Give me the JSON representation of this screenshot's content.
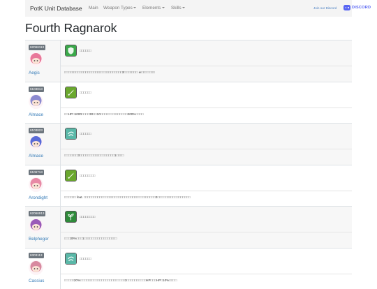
{
  "nav": {
    "brand": "PotK Unit Database",
    "items": [
      {
        "label": "Main",
        "dropdown": false
      },
      {
        "label": "Weapon Types",
        "dropdown": true
      },
      {
        "label": "Elements",
        "dropdown": true
      },
      {
        "label": "Skills",
        "dropdown": true
      }
    ],
    "join_text": "Join our Discord",
    "discord_text": "DISCORD"
  },
  "page": {
    "title": "Fourth Ragnarok"
  },
  "colors": {
    "navbar_bg": "#f4f4f4",
    "link": "#337ab7",
    "badge": "#6c757d",
    "discord": "#5865f2"
  },
  "units": [
    {
      "id": "62066113",
      "name": "Aegis",
      "icon": "shield-skill-icon",
      "skill_name": "□□□□□□",
      "skill_desc": "□□□□□□□□□□□□□□□□□□□□□□□□□□□□□□2□□□□□□□ ※□□□□□□□",
      "avatar_hair": "#e8789a",
      "icon_color": "#3aa84a"
    },
    {
      "id": "6103813",
      "name": "Almace",
      "icon": "sword-skill-icon",
      "skill_name": "□□□□□□",
      "skill_desc": "□□HP□1000□□□□30□□10□□□□□□□□□□□□□□200%□□□□",
      "avatar_hair": "#8c8ad0",
      "icon_color": "#6aa82e"
    },
    {
      "id": "6103823",
      "name": "Almace",
      "icon": "wind-skill-icon",
      "skill_name": "□□□□□□",
      "skill_desc": "□□□□□□□3□□□□□□□□□□□□□□□□□□1□□□□",
      "avatar_hair": "#5a6bd8",
      "icon_color": "#5ab8a8"
    },
    {
      "id": "6106713",
      "name": "Arondight",
      "icon": "sword-skill-icon",
      "skill_name": "□□□□□□□□",
      "skill_desc": "□□□□□□ feat. □□□□□□□□□□□□□□□□□□□□□□□□□□□□□□□□□□□□□2□□□□□□□□□□□□□□□□□",
      "avatar_hair": "#e88aa6",
      "icon_color": "#6aa82e"
    },
    {
      "id": "62066913",
      "name": "Belphegor",
      "icon": "plant-skill-icon",
      "skill_name": "□□□□□□□□",
      "skill_desc": "□□□30%□□□1□□□□□□□□□□□□□□□□□",
      "avatar_hair": "#9a5ab8",
      "icon_color": "#2e8a3a"
    },
    {
      "id": "6303113",
      "name": "Cassius",
      "icon": "wind-skill-icon",
      "skill_name": "□□□□□□",
      "skill_desc": "□□□□□20%□□□□□□□□□□□□□□□□□□□□□□□3□□□□□□□□□□HP□□□HP□10%□□□□",
      "avatar_hair": "#d88aa0",
      "icon_color": "#5ab8a8"
    }
  ]
}
